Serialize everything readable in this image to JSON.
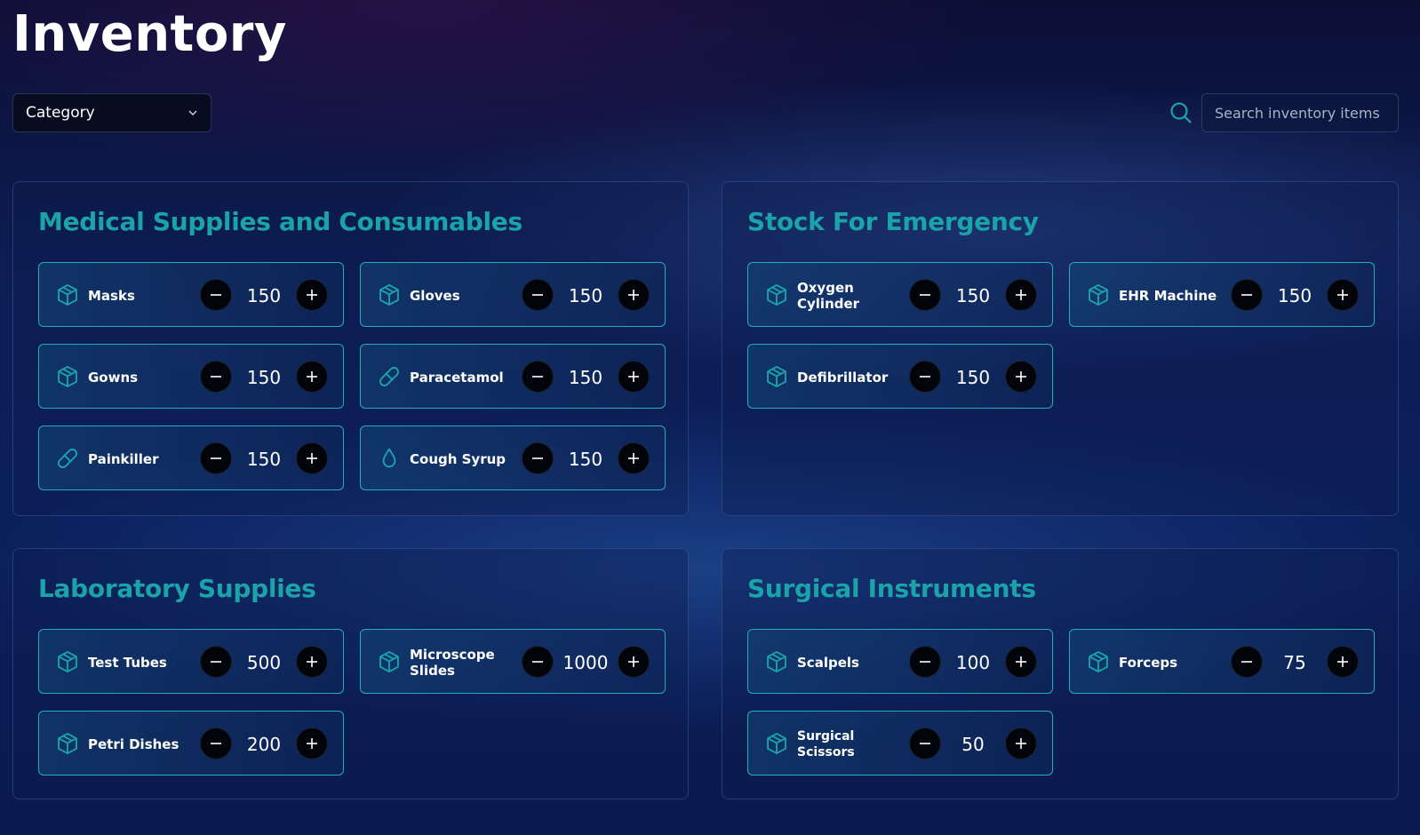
{
  "page": {
    "title": "Inventory"
  },
  "filters": {
    "category_label": "Category",
    "search_placeholder": "Search inventory items"
  },
  "colors": {
    "accent": "#1aa3a8",
    "card_border": "#1fb0b8",
    "button_bg": "#02040a",
    "background": "#0d1e55"
  },
  "sections": [
    {
      "title": "Medical Supplies and Consumables",
      "items": [
        {
          "name": "Masks",
          "icon": "box-icon",
          "qty": 150
        },
        {
          "name": "Gloves",
          "icon": "box-icon",
          "qty": 150
        },
        {
          "name": "Gowns",
          "icon": "box-icon",
          "qty": 150
        },
        {
          "name": "Paracetamol",
          "icon": "pill-icon",
          "qty": 150
        },
        {
          "name": "Painkiller",
          "icon": "pill-icon",
          "qty": 150
        },
        {
          "name": "Cough Syrup",
          "icon": "drop-icon",
          "qty": 150
        }
      ]
    },
    {
      "title": "Stock For Emergency",
      "items": [
        {
          "name": "Oxygen Cylinder",
          "icon": "box-icon",
          "qty": 150
        },
        {
          "name": "EHR Machine",
          "icon": "box-icon",
          "qty": 150
        },
        {
          "name": "Defibrillator",
          "icon": "box-icon",
          "qty": 150
        }
      ]
    },
    {
      "title": "Laboratory Supplies",
      "items": [
        {
          "name": "Test Tubes",
          "icon": "box-icon",
          "qty": 500
        },
        {
          "name": "Microscope Slides",
          "icon": "box-icon",
          "qty": 1000
        },
        {
          "name": "Petri Dishes",
          "icon": "box-icon",
          "qty": 200
        }
      ]
    },
    {
      "title": "Surgical Instruments",
      "items": [
        {
          "name": "Scalpels",
          "icon": "box-icon",
          "qty": 100
        },
        {
          "name": "Forceps",
          "icon": "box-icon",
          "qty": 75
        },
        {
          "name": "Surgical Scissors",
          "icon": "box-icon",
          "qty": 50
        }
      ]
    }
  ]
}
